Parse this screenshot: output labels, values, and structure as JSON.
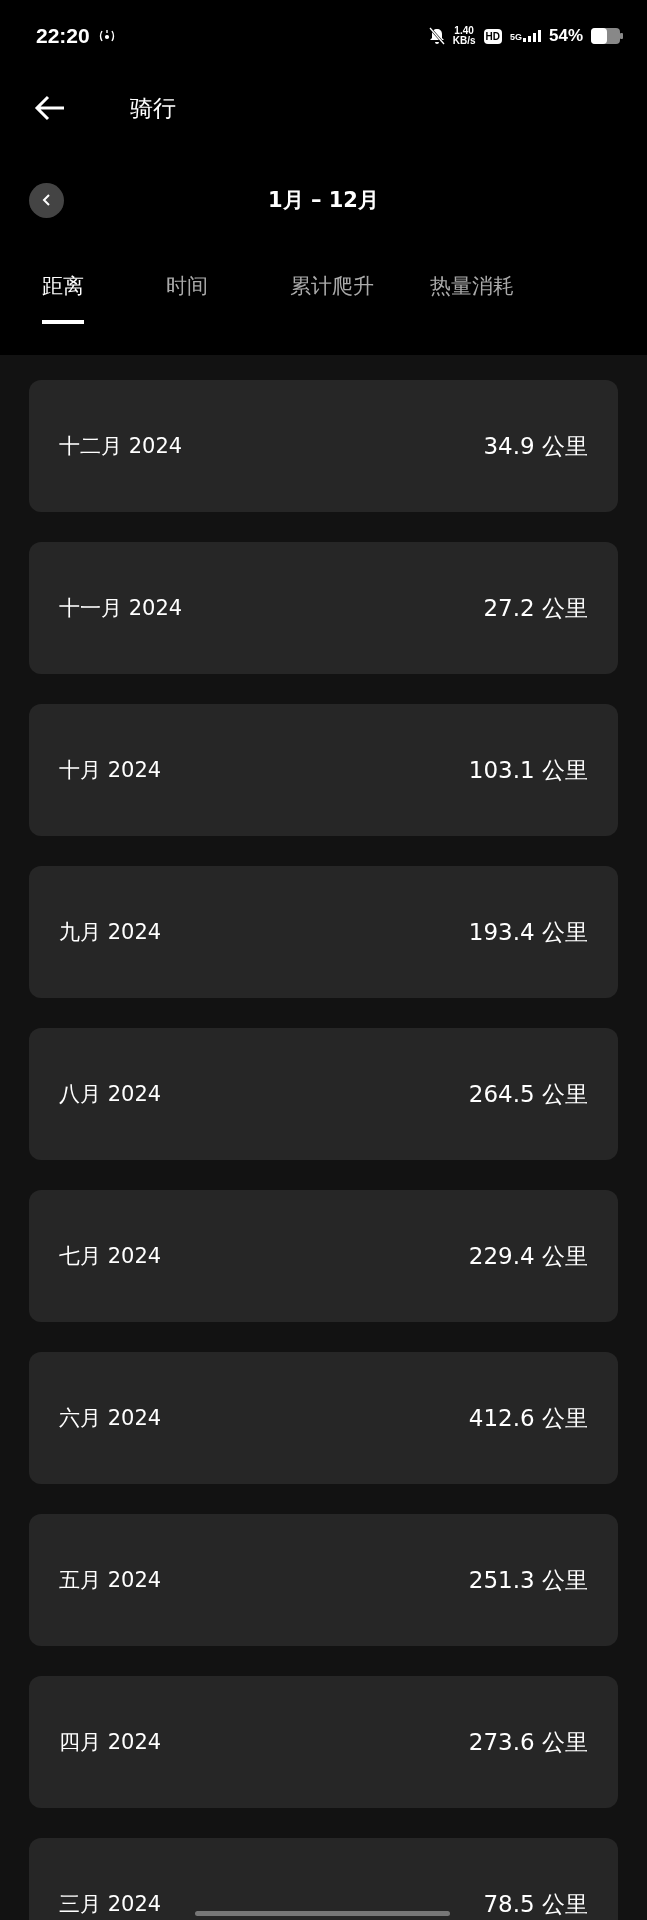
{
  "status_bar": {
    "time": "22:20",
    "net_speed": "1.40",
    "net_unit": "KB/s",
    "hd": "HD",
    "network": "5G",
    "battery": "54%"
  },
  "header": {
    "title": "骑行"
  },
  "range": {
    "label": "1月 – 12月"
  },
  "tabs": [
    {
      "label": "距离",
      "selected": true
    },
    {
      "label": "时间",
      "selected": false
    },
    {
      "label": "累计爬升",
      "selected": false
    },
    {
      "label": "热量消耗",
      "selected": false
    }
  ],
  "months": [
    {
      "month": "十二月 2024",
      "value": "34.9 公里"
    },
    {
      "month": "十一月 2024",
      "value": "27.2 公里"
    },
    {
      "month": "十月 2024",
      "value": "103.1 公里"
    },
    {
      "month": "九月 2024",
      "value": "193.4 公里"
    },
    {
      "month": "八月 2024",
      "value": "264.5 公里"
    },
    {
      "month": "七月 2024",
      "value": "229.4 公里"
    },
    {
      "month": "六月 2024",
      "value": "412.6 公里"
    },
    {
      "month": "五月 2024",
      "value": "251.3 公里"
    },
    {
      "month": "四月 2024",
      "value": "273.6 公里"
    },
    {
      "month": "三月 2024",
      "value": "78.5 公里"
    }
  ]
}
